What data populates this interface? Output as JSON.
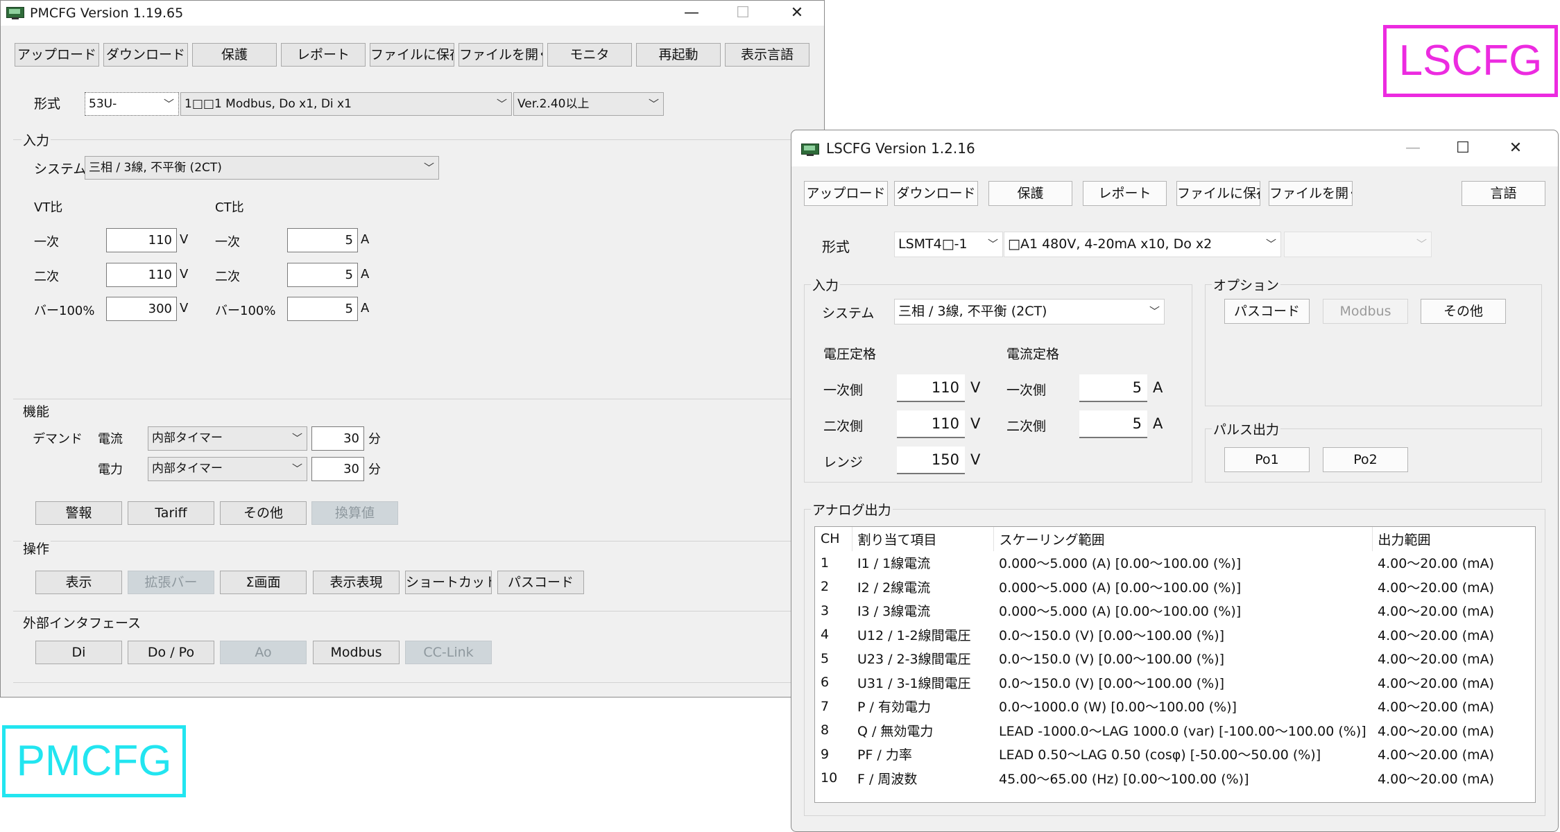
{
  "pmcfg": {
    "title": "PMCFG Version 1.19.65",
    "toolbar": [
      "アップロード",
      "ダウンロード",
      "保護",
      "レポート",
      "ファイルに保存",
      "ファイルを開く",
      "モニタ",
      "再起動",
      "表示言語"
    ],
    "model_label": "形式",
    "model_select": "53U-",
    "model_option": "1□□1 Modbus, Do x1, Di x1",
    "version_select": "Ver.2.40以上",
    "input_group": "入力",
    "system_label": "システム",
    "system_value": "三相 / 3線, 不平衡 (2CT)",
    "vt_label": "VT比",
    "ct_label": "CT比",
    "primary_label": "一次",
    "secondary_label": "二次",
    "bar_label": "バー100%",
    "vt_primary": "110",
    "vt_secondary": "110",
    "vt_bar": "300",
    "ct_primary": "5",
    "ct_secondary": "5",
    "ct_bar": "5",
    "unit_v": "V",
    "unit_a": "A",
    "function_group": "機能",
    "demand_label": "デマンド",
    "current_label": "電流",
    "power_label": "電力",
    "timer_option": "内部タイマー",
    "demand_current_min": "30",
    "demand_power_min": "30",
    "unit_min": "分",
    "function_buttons": [
      "警報",
      "Tariff",
      "その他",
      "換算値"
    ],
    "operation_group": "操作",
    "operation_buttons": [
      "表示",
      "拡張バー",
      "Σ画面",
      "表示表現",
      "ショートカット",
      "パスコード"
    ],
    "external_group": "外部インタフェース",
    "external_buttons": [
      "Di",
      "Do / Po",
      "Ao",
      "Modbus",
      "CC-Link"
    ],
    "tag": "PMCFG",
    "tag_color": "#22e5f0"
  },
  "lscfg": {
    "title": "LSCFG Version 1.2.16",
    "toolbar": [
      "アップロード",
      "ダウンロード",
      "保護",
      "レポート",
      "ファイルに保存",
      "ファイルを開く"
    ],
    "language_button": "言語",
    "model_label": "形式",
    "model_select": "LSMT4□-1",
    "model_option": "□A1 480V, 4-20mA x10, Do x2",
    "input_group": "入力",
    "system_label": "システム",
    "system_value": "三相 / 3線, 不平衡 (2CT)",
    "voltage_rating": "電圧定格",
    "current_rating": "電流定格",
    "primary_label": "一次側",
    "secondary_label": "二次側",
    "range_label": "レンジ",
    "v_primary": "110",
    "v_secondary": "110",
    "v_range": "150",
    "i_primary": "5",
    "i_secondary": "5",
    "unit_v": "V",
    "unit_a": "A",
    "option_group": "オプション",
    "option_buttons": [
      "パスコード",
      "Modbus",
      "その他"
    ],
    "pulse_group": "パルス出力",
    "pulse_buttons": [
      "Po1",
      "Po2"
    ],
    "analog_group": "アナログ出力",
    "table_headers": [
      "CH",
      "割り当て項目",
      "スケーリング範囲",
      "出力範囲"
    ],
    "table_rows": [
      [
        "1",
        "I1 / 1線電流",
        "0.000～5.000 (A) [0.00～100.00 (%)]",
        "4.00～20.00 (mA)"
      ],
      [
        "2",
        "I2 / 2線電流",
        "0.000～5.000 (A) [0.00～100.00 (%)]",
        "4.00～20.00 (mA)"
      ],
      [
        "3",
        "I3 / 3線電流",
        "0.000～5.000 (A) [0.00～100.00 (%)]",
        "4.00～20.00 (mA)"
      ],
      [
        "4",
        "U12 / 1-2線間電圧",
        "0.0～150.0 (V) [0.00～100.00 (%)]",
        "4.00～20.00 (mA)"
      ],
      [
        "5",
        "U23 / 2-3線間電圧",
        "0.0～150.0 (V) [0.00～100.00 (%)]",
        "4.00～20.00 (mA)"
      ],
      [
        "6",
        "U31 / 3-1線間電圧",
        "0.0～150.0 (V) [0.00～100.00 (%)]",
        "4.00～20.00 (mA)"
      ],
      [
        "7",
        "P / 有効電力",
        "0.0～1000.0 (W) [0.00～100.00 (%)]",
        "4.00～20.00 (mA)"
      ],
      [
        "8",
        "Q / 無効電力",
        "LEAD -1000.0～LAG 1000.0 (var) [-100.00～100.00 (%)]",
        "4.00～20.00 (mA)"
      ],
      [
        "9",
        "PF / 力率",
        "LEAD 0.50～LAG 0.50 (cosφ) [-50.00～50.00 (%)]",
        "4.00～20.00 (mA)"
      ],
      [
        "10",
        "F / 周波数",
        "45.00～65.00 (Hz) [0.00～100.00 (%)]",
        "4.00～20.00 (mA)"
      ]
    ],
    "tag": "LSCFG",
    "tag_color": "#ec2be0"
  },
  "window_controls": {
    "minimize": "—",
    "maximize": "☐",
    "close": "✕"
  }
}
